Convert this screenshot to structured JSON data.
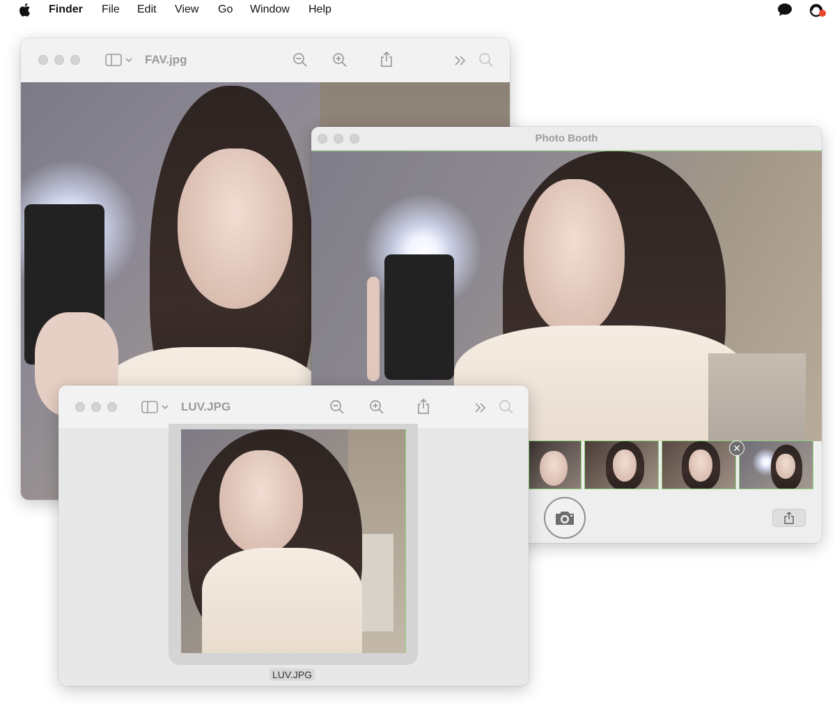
{
  "menubar": {
    "app_name": "Finder",
    "items": [
      "File",
      "Edit",
      "View",
      "Go",
      "Window",
      "Help"
    ]
  },
  "icons": {
    "apple": "apple-logo-icon",
    "messages": "speech-bubble-icon",
    "control_center": "control-center-icon",
    "sidebar": "sidebar-toggle-icon",
    "zoom_out": "zoom-out-icon",
    "zoom_in": "zoom-in-icon",
    "share": "share-icon",
    "more": "chevron-double-right-icon",
    "search": "search-icon",
    "camera": "camera-icon",
    "close": "close-icon"
  },
  "fav_window": {
    "title": "FAV.jpg"
  },
  "photo_booth": {
    "title": "Photo Booth"
  },
  "luv_window": {
    "title": "LUV.JPG",
    "file_label": "LUV.JPG"
  },
  "colors": {
    "window_bg": "#ececec",
    "toolbar_bg": "#f2f2f2",
    "title_gray": "#9a9a9a",
    "selection_green": "#8fd07a",
    "notification_dot": "#e8452c"
  }
}
